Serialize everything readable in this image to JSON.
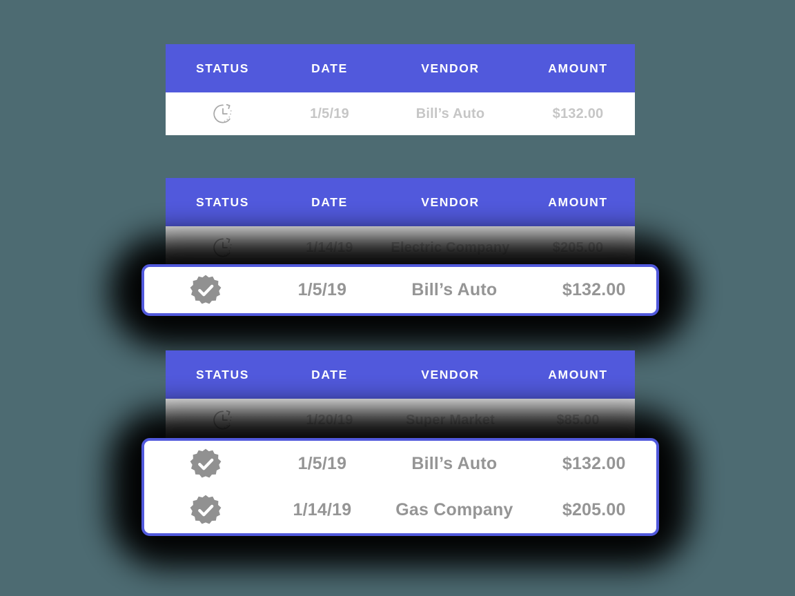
{
  "theme": {
    "background": "#4d6b72",
    "header_blue": "#5159dc",
    "card_white": "#ffffff",
    "pending_text": "#c6c6c6",
    "active_text": "#959595",
    "badge_gray": "#919191"
  },
  "columns": {
    "status": "STATUS",
    "date": "DATE",
    "vendor": "VENDOR",
    "amount": "AMOUNT"
  },
  "icons": {
    "pending": "clock-pending-icon",
    "verified": "verified-badge-check-icon"
  },
  "groups": [
    {
      "id": "group-1",
      "pending_rows": [
        {
          "status_icon": "clock-pending-icon",
          "date": "1/5/19",
          "vendor": "Bill’s Auto",
          "amount": "$132.00"
        }
      ],
      "highlighted_rows": []
    },
    {
      "id": "group-2",
      "pending_rows": [
        {
          "status_icon": "clock-pending-icon",
          "date": "1/14/19",
          "vendor": "Electric Company",
          "amount": "$205.00"
        }
      ],
      "highlighted_rows": [
        {
          "status_icon": "verified-badge-check-icon",
          "date": "1/5/19",
          "vendor": "Bill’s Auto",
          "amount": "$132.00"
        }
      ]
    },
    {
      "id": "group-3",
      "pending_rows": [
        {
          "status_icon": "clock-pending-icon",
          "date": "1/20/19",
          "vendor": "Super Market",
          "amount": "$85.00"
        }
      ],
      "highlighted_rows": [
        {
          "status_icon": "verified-badge-check-icon",
          "date": "1/5/19",
          "vendor": "Bill’s Auto",
          "amount": "$132.00"
        },
        {
          "status_icon": "verified-badge-check-icon",
          "date": "1/14/19",
          "vendor": "Gas Company",
          "amount": "$205.00"
        }
      ]
    }
  ]
}
